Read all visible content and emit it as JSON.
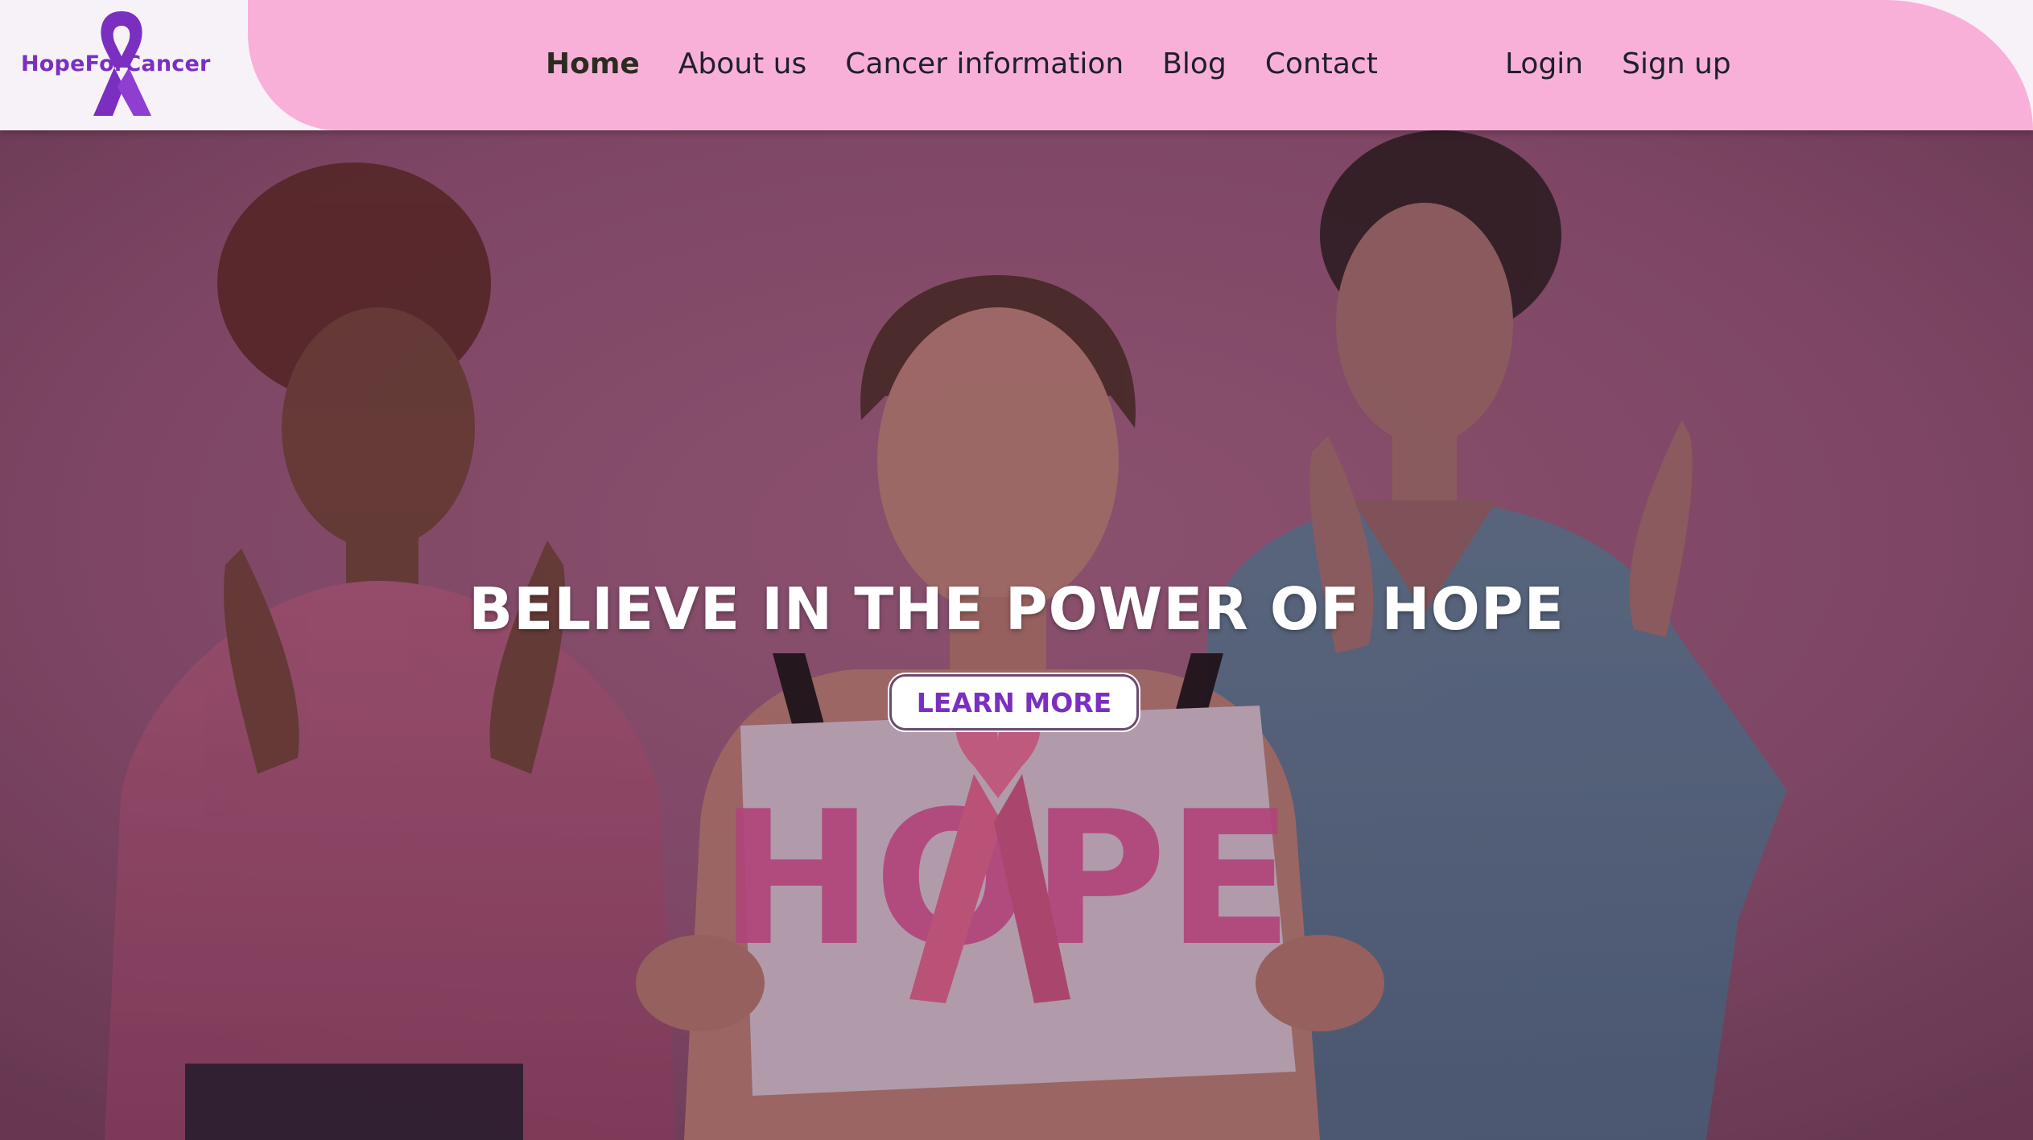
{
  "header": {
    "logo_text": "HopeForCancer",
    "nav": [
      {
        "label": "Home",
        "active": true
      },
      {
        "label": "About us"
      },
      {
        "label": "Cancer information"
      },
      {
        "label": "Blog"
      },
      {
        "label": "Contact"
      }
    ],
    "auth": [
      {
        "label": "Login"
      },
      {
        "label": "Sign up"
      }
    ]
  },
  "hero": {
    "title": "BELIEVE IN THE POWER OF HOPE",
    "button_label": "LEARN MORE",
    "sign_text": "HOPE"
  },
  "colors": {
    "brand_purple": "#7b2fc0",
    "header_pink": "#f8b0d8",
    "hero_background": "#8c5470",
    "sign_pink": "#c84c8a"
  },
  "icons": {
    "logo": "awareness-ribbon-icon"
  }
}
